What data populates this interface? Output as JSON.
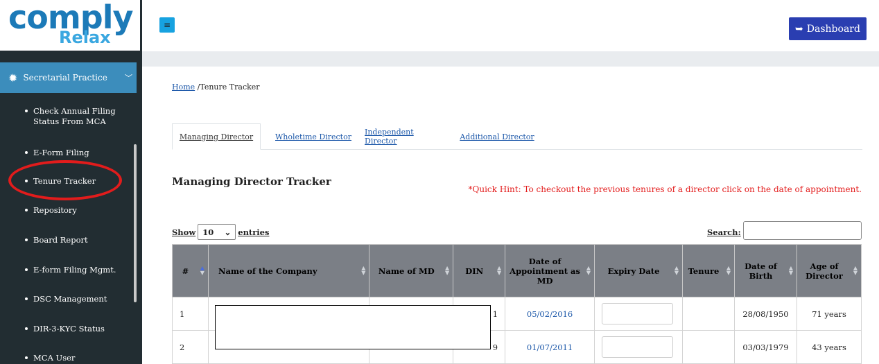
{
  "logo": {
    "main": "comply",
    "sub": "Relax"
  },
  "sidebar": {
    "section": "Secretarial Practice",
    "items": [
      {
        "label": "Check Annual Filing Status From MCA"
      },
      {
        "label": "E-Form Filing"
      },
      {
        "label": "Tenure Tracker"
      },
      {
        "label": "Repository"
      },
      {
        "label": "Board Report"
      },
      {
        "label": "E-form Filing Mgmt."
      },
      {
        "label": "DSC Management"
      },
      {
        "label": "DIR-3-KYC Status"
      },
      {
        "label": "MCA User"
      }
    ]
  },
  "topbar": {
    "menu_icon": "≡",
    "dashboard_label": "Dashboard"
  },
  "breadcrumb": {
    "home": "Home",
    "separator": " /",
    "current": "Tenure Tracker"
  },
  "tabs": [
    "Managing Director",
    "Wholetime Director",
    "Independent Director",
    "Additional Director"
  ],
  "tracker": {
    "title": "Managing Director Tracker",
    "hint": "*Quick Hint: To checkout the previous tenures of a director click on the date of appointment."
  },
  "table_controls": {
    "show": "Show",
    "entries_value": "10",
    "entries": "entries",
    "search": "Search:"
  },
  "table": {
    "headers": [
      "#",
      "Name of the Company",
      "Name of MD",
      "DIN",
      "Date of Appointment as MD",
      "Expiry Date",
      "Tenure",
      "Date of Birth",
      "Age of Director"
    ],
    "rows": [
      {
        "num": "1",
        "din_tail": "1",
        "appointment": "05/02/2016",
        "dob": "28/08/1950",
        "age": "71 years"
      },
      {
        "num": "2",
        "din_tail": "9",
        "appointment": "01/07/2011",
        "dob": "03/03/1979",
        "age": "43 years"
      }
    ]
  },
  "colors": {
    "sidebar": "#222d32",
    "section": "#3c8dbc",
    "dashboard_btn": "#2a3eb1",
    "header": "#7b7f86",
    "hint": "#e31d1d"
  }
}
